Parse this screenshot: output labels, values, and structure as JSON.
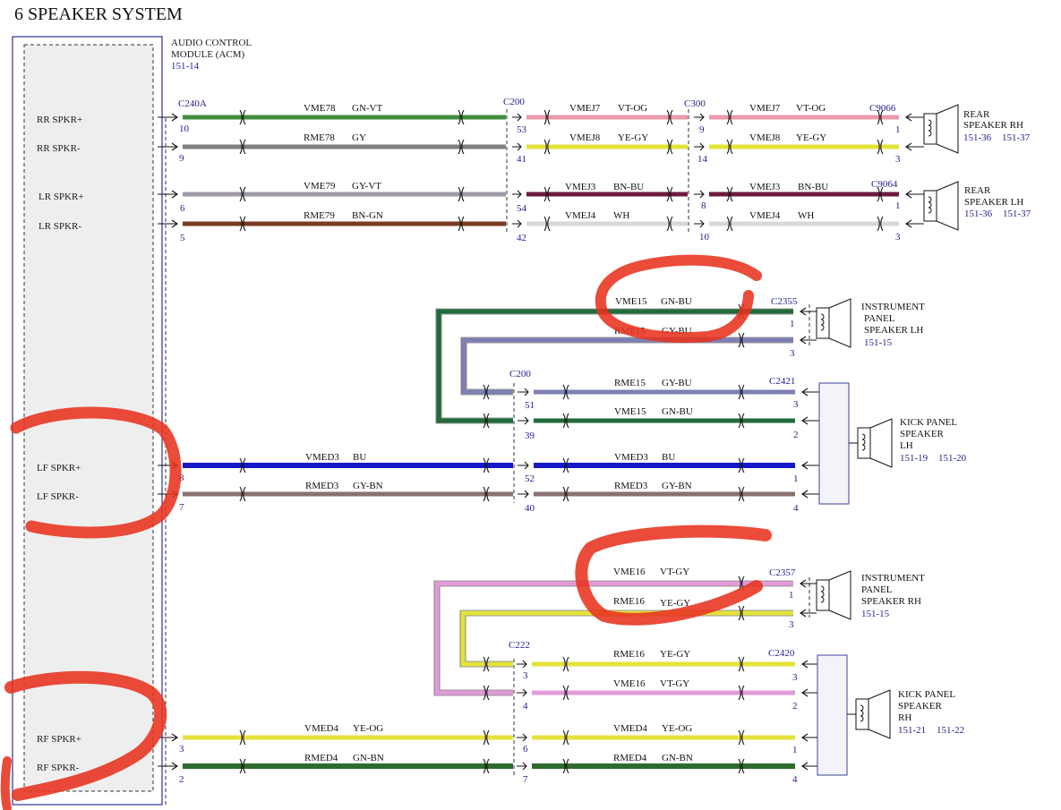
{
  "title": "6 SPEAKER SYSTEM",
  "module": {
    "lines": [
      "AUDIO CONTROL",
      "MODULE (ACM)"
    ],
    "ref": "151-14",
    "pins": [
      {
        "id": "rr_pos",
        "label": "RR SPKR+"
      },
      {
        "id": "rr_neg",
        "label": "RR SPKR-"
      },
      {
        "id": "lr_pos",
        "label": "LR SPKR+"
      },
      {
        "id": "lr_neg",
        "label": "LR SPKR-"
      },
      {
        "id": "lf_pos",
        "label": "LF SPKR+"
      },
      {
        "id": "lf_neg",
        "label": "LF SPKR-"
      },
      {
        "id": "rf_pos",
        "label": "RF SPKR+"
      },
      {
        "id": "rf_neg",
        "label": "RF SPKR-"
      }
    ]
  },
  "connectors": [
    {
      "id": "c240a",
      "label": "C240A"
    },
    {
      "id": "c200a",
      "label": "C200"
    },
    {
      "id": "c300",
      "label": "C300"
    },
    {
      "id": "c9066",
      "label": "C9066"
    },
    {
      "id": "c9064",
      "label": "C9064"
    },
    {
      "id": "c2355",
      "label": "C2355"
    },
    {
      "id": "c200b",
      "label": "C200"
    },
    {
      "id": "c2421",
      "label": "C2421"
    },
    {
      "id": "c2357",
      "label": "C2357"
    },
    {
      "id": "c222",
      "label": "C222"
    },
    {
      "id": "c2420",
      "label": "C2420"
    }
  ],
  "speakers": [
    {
      "id": "rear_rh",
      "lines": [
        "REAR",
        "SPEAKER RH"
      ],
      "refs": [
        "151-36",
        "151-37"
      ]
    },
    {
      "id": "rear_lh",
      "lines": [
        "REAR",
        "SPEAKER LH"
      ],
      "refs": [
        "151-36",
        "151-37"
      ]
    },
    {
      "id": "ip_lh",
      "lines": [
        "INSTRUMENT",
        "PANEL",
        "SPEAKER LH"
      ],
      "refs": [
        "151-15"
      ]
    },
    {
      "id": "kick_lh",
      "lines": [
        "KICK PANEL",
        "SPEAKER",
        "LH"
      ],
      "refs": [
        "151-19",
        "151-20"
      ]
    },
    {
      "id": "ip_rh",
      "lines": [
        "INSTRUMENT",
        "PANEL",
        "SPEAKER RH"
      ],
      "refs": [
        "151-15"
      ]
    },
    {
      "id": "kick_rh",
      "lines": [
        "KICK PANEL",
        "SPEAKER",
        "RH"
      ],
      "refs": [
        "151-21",
        "151-22"
      ]
    }
  ],
  "wires": [
    {
      "id": "vme78",
      "circuit": "VME78",
      "color_code": "GN-VT",
      "color": "#3f8f3f",
      "stripe": "#9a6fa0"
    },
    {
      "id": "rme78",
      "circuit": "RME78",
      "color_code": "GY",
      "color": "#808080"
    },
    {
      "id": "vmej7a",
      "circuit": "VMEJ7",
      "color_code": "VT-OG",
      "color": "#e89aaa"
    },
    {
      "id": "vmej8a",
      "circuit": "VMEJ8",
      "color_code": "YE-GY",
      "color": "#e3e33a",
      "stripe": "#9a9a9a"
    },
    {
      "id": "vmej7b",
      "circuit": "VMEJ7",
      "color_code": "VT-OG",
      "color": "#e89aaa"
    },
    {
      "id": "vmej8b",
      "circuit": "VMEJ8",
      "color_code": "YE-GY",
      "color": "#e3e33a",
      "stripe": "#9a9a9a"
    },
    {
      "id": "vme79",
      "circuit": "VME79",
      "color_code": "GY-VT",
      "color": "#a09aa8"
    },
    {
      "id": "rme79",
      "circuit": "RME79",
      "color_code": "BN-GN",
      "color": "#7a3b1e"
    },
    {
      "id": "vmej3a",
      "circuit": "VMEJ3",
      "color_code": "BN-BU",
      "color": "#6e1a3c"
    },
    {
      "id": "vmej4a",
      "circuit": "VMEJ4",
      "color_code": "WH",
      "color": "#d8d8d8"
    },
    {
      "id": "vmej3b",
      "circuit": "VMEJ3",
      "color_code": "BN-BU",
      "color": "#6e1a3c"
    },
    {
      "id": "vmej4b",
      "circuit": "VMEJ4",
      "color_code": "WH",
      "color": "#d8d8d8"
    },
    {
      "id": "vme15a",
      "circuit": "VME15",
      "color_code": "GN-BU",
      "color": "#1f6b3a"
    },
    {
      "id": "rme15a",
      "circuit": "RME15",
      "color_code": "GY-BU",
      "color": "#7d7fb5"
    },
    {
      "id": "rme15b",
      "circuit": "RME15",
      "color_code": "GY-BU",
      "color": "#7d7fb5"
    },
    {
      "id": "vme15b",
      "circuit": "VME15",
      "color_code": "GN-BU",
      "color": "#1f6b3a"
    },
    {
      "id": "vmed3a",
      "circuit": "VMED3",
      "color_code": "BU",
      "color": "#1418c8"
    },
    {
      "id": "rmed3a",
      "circuit": "RMED3",
      "color_code": "GY-BN",
      "color": "#8a7070"
    },
    {
      "id": "vmed3b",
      "circuit": "VMED3",
      "color_code": "BU",
      "color": "#1418c8"
    },
    {
      "id": "rmed3b",
      "circuit": "RMED3",
      "color_code": "GY-BN",
      "color": "#8a7070"
    },
    {
      "id": "vme16a",
      "circuit": "VME16",
      "color_code": "VT-GY",
      "color": "#e29ad8"
    },
    {
      "id": "rme16a",
      "circuit": "RME16",
      "color_code": "YE-GY",
      "color": "#e3e33a"
    },
    {
      "id": "rme16b",
      "circuit": "RME16",
      "color_code": "YE-GY",
      "color": "#e3e33a"
    },
    {
      "id": "vme16b",
      "circuit": "VME16",
      "color_code": "VT-GY",
      "color": "#e29ad8"
    },
    {
      "id": "vmed4a",
      "circuit": "VMED4",
      "color_code": "YE-OG",
      "color": "#e8e23c"
    },
    {
      "id": "rmed4a",
      "circuit": "RMED4",
      "color_code": "GN-BN",
      "color": "#2e6b2e"
    },
    {
      "id": "vmed4b",
      "circuit": "VMED4",
      "color_code": "YE-OG",
      "color": "#e8e23c"
    },
    {
      "id": "rmed4b",
      "circuit": "RMED4",
      "color_code": "GN-BN",
      "color": "#2e6b2e"
    }
  ],
  "pins": [
    {
      "id": "p10",
      "label": "10"
    },
    {
      "id": "p9",
      "label": "9"
    },
    {
      "id": "p6",
      "label": "6"
    },
    {
      "id": "p5",
      "label": "5"
    },
    {
      "id": "p53",
      "label": "53"
    },
    {
      "id": "p41",
      "label": "41"
    },
    {
      "id": "p54",
      "label": "54"
    },
    {
      "id": "p42",
      "label": "42"
    },
    {
      "id": "p9b",
      "label": "9"
    },
    {
      "id": "p14",
      "label": "14"
    },
    {
      "id": "p8b",
      "label": "8"
    },
    {
      "id": "p10b",
      "label": "10"
    },
    {
      "id": "p1a",
      "label": "1"
    },
    {
      "id": "p3a",
      "label": "3"
    },
    {
      "id": "p1b",
      "label": "1"
    },
    {
      "id": "p3b",
      "label": "3"
    },
    {
      "id": "p1c",
      "label": "1"
    },
    {
      "id": "p3c",
      "label": "3"
    },
    {
      "id": "p51",
      "label": "51"
    },
    {
      "id": "p39",
      "label": "39"
    },
    {
      "id": "p52",
      "label": "52"
    },
    {
      "id": "p40",
      "label": "40"
    },
    {
      "id": "p3d",
      "label": "3"
    },
    {
      "id": "p2d",
      "label": "2"
    },
    {
      "id": "p1d",
      "label": "1"
    },
    {
      "id": "p4d",
      "label": "4"
    },
    {
      "id": "p8",
      "label": "8"
    },
    {
      "id": "p7",
      "label": "7"
    },
    {
      "id": "p1e",
      "label": "1"
    },
    {
      "id": "p3e",
      "label": "3"
    },
    {
      "id": "p3f",
      "label": "3"
    },
    {
      "id": "p4f",
      "label": "4"
    },
    {
      "id": "p3g",
      "label": "3"
    },
    {
      "id": "p2g",
      "label": "2"
    },
    {
      "id": "p1g",
      "label": "1"
    },
    {
      "id": "p4g",
      "label": "4"
    },
    {
      "id": "p3h",
      "label": "3"
    },
    {
      "id": "p2h",
      "label": "2"
    },
    {
      "id": "p6i",
      "label": "6"
    },
    {
      "id": "p7i",
      "label": "7"
    }
  ],
  "highlight_color": "#e8321e"
}
